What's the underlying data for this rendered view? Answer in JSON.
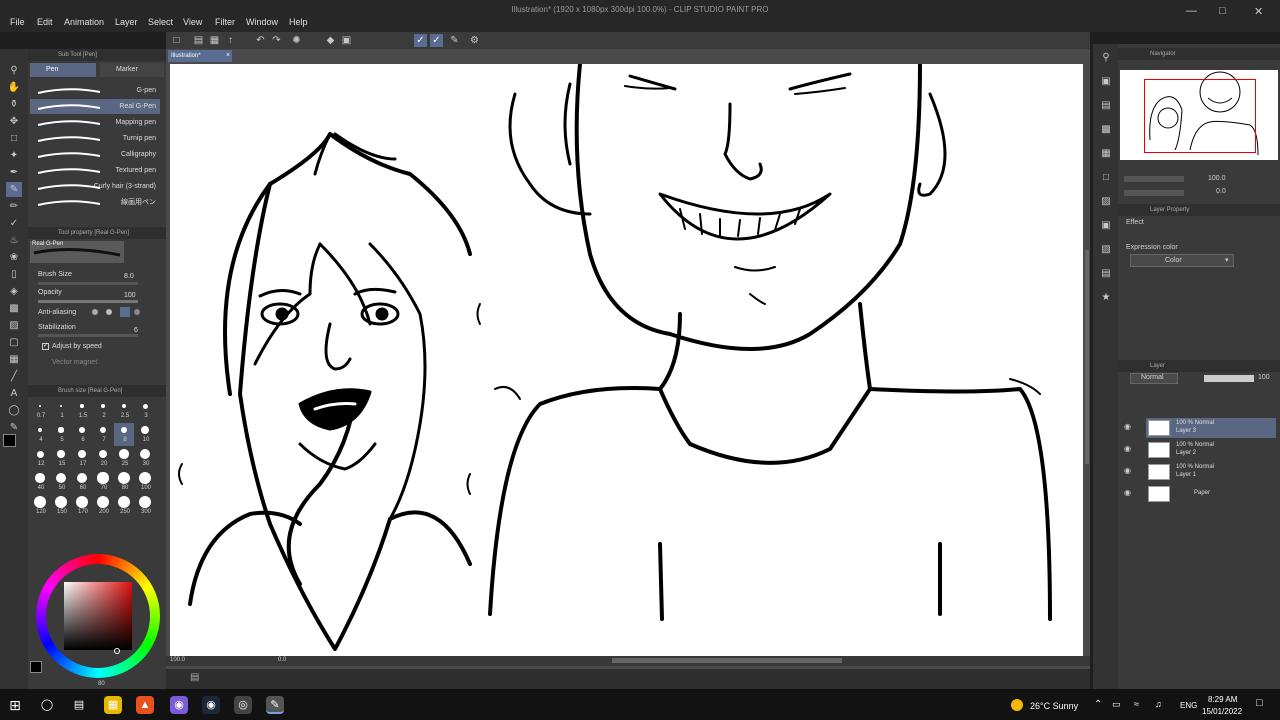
{
  "menu": [
    "File",
    "Edit",
    "Animation",
    "Layer",
    "Select",
    "View",
    "Filter",
    "Window",
    "Help"
  ],
  "window_title": "Illustration* (1920 x 1080px 300dpi 100.0%) - CLIP STUDIO PAINT PRO",
  "doc_tab": "Illustration*",
  "subtool": {
    "header": "Sub Tool [Pen]",
    "tabs": [
      "Pen",
      "Marker"
    ],
    "brushes": [
      "G-pen",
      "Real G-Pen",
      "Mapping pen",
      "Turnip pen",
      "Calligraphy",
      "Textured pen",
      "Curly hair (3-strand)",
      "線画用ペン"
    ],
    "active_index": 1
  },
  "tool_property": {
    "header": "Tool property [Real G-Pen]",
    "preview_label": "Real G-Pen",
    "brush_size_label": "Brush Size",
    "brush_size_value": "8.0",
    "opacity_label": "Opacity",
    "opacity_value": "100",
    "antialias_label": "Anti-aliasing",
    "stabilization_label": "Stabilization",
    "stabilization_value": "6",
    "adjust_label": "Adjust by speed",
    "vector_label": "Vector magnet"
  },
  "brush_size_panel": {
    "header": "Brush size [Real G-Pen]",
    "sizes": [
      "0.7",
      "1",
      "1.5",
      "2",
      "2.5",
      "3",
      "4",
      "5",
      "6",
      "7",
      "8",
      "10",
      "12",
      "15",
      "17",
      "20",
      "25",
      "30",
      "40",
      "50",
      "60",
      "70",
      "80",
      "100",
      "120",
      "150",
      "170",
      "200",
      "250",
      "300"
    ],
    "active": "8"
  },
  "color_status": "80",
  "canvas_status": {
    "zoom": "100.0",
    "angle": "0.0"
  },
  "navigator": {
    "header": "Navigator",
    "zoom": "100.0",
    "angle": "0.0"
  },
  "layer_property": {
    "header": "Layer Property",
    "effect_label": "Effect",
    "expression_label": "Expression color",
    "expression_value": "Color"
  },
  "layers": {
    "header": "Layer",
    "blend_mode": "Normal",
    "opacity": "100",
    "items": [
      {
        "meta": "100 % Normal",
        "name": "Layer 3"
      },
      {
        "meta": "100 % Normal",
        "name": "Layer 2"
      },
      {
        "meta": "100 % Normal",
        "name": "Layer 1"
      },
      {
        "meta": "",
        "name": "Paper"
      }
    ]
  },
  "taskbar": {
    "weather": "26°C  Sunny",
    "lang": "ENG",
    "time": "8:29 AM",
    "date": "15/01/2022"
  }
}
